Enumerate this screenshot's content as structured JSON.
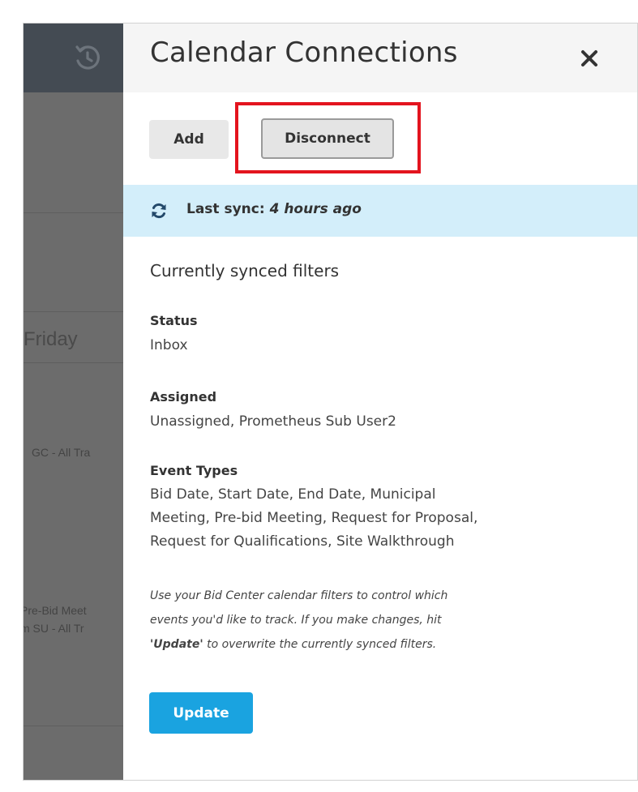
{
  "background": {
    "day_label": "Friday",
    "event_snippets": [
      "GC - All Tra",
      "Pre-Bid Meet",
      "m SU - All Tr"
    ]
  },
  "panel": {
    "title": "Calendar Connections",
    "close_icon": "close-icon",
    "buttons": {
      "add": "Add",
      "disconnect": "Disconnect"
    },
    "sync": {
      "icon": "refresh-icon",
      "label": "Last sync:",
      "value": "4 hours ago"
    },
    "section_title": "Currently synced filters",
    "filters": {
      "status_label": "Status",
      "status_value": "Inbox",
      "assigned_label": "Assigned",
      "assigned_value": "Unassigned, Prometheus Sub User2",
      "event_types_label": "Event Types",
      "event_types_line1": "Bid Date, Start Date, End Date, Municipal",
      "event_types_line2": "Meeting, Pre-bid Meeting, Request for Proposal,",
      "event_types_line3": "Request for Qualifications, Site Walkthrough"
    },
    "help": {
      "line1": "Use your Bid Center calendar filters to control which",
      "line2": "events you'd like to track. If you make changes, hit",
      "update_word": "'Update'",
      "line3_rest": " to overwrite the currently synced filters."
    },
    "update_button": "Update"
  },
  "colors": {
    "accent": "#1aa3e0",
    "sync_banner": "#d3eefa",
    "highlight": "#e3141e",
    "header_dark": "#444b53"
  }
}
